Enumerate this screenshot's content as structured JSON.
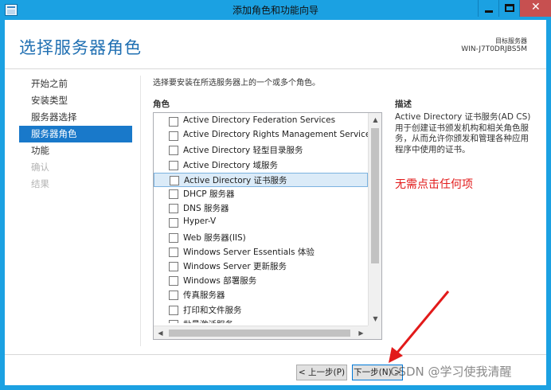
{
  "window": {
    "title": "添加角色和功能向导"
  },
  "header": {
    "page_title": "选择服务器角色",
    "target_label": "目标服务器",
    "target_name": "WIN-J7T0DRJBS5M"
  },
  "nav": {
    "items": [
      {
        "label": "开始之前",
        "state": "normal"
      },
      {
        "label": "安装类型",
        "state": "normal"
      },
      {
        "label": "服务器选择",
        "state": "normal"
      },
      {
        "label": "服务器角色",
        "state": "active"
      },
      {
        "label": "功能",
        "state": "normal"
      },
      {
        "label": "确认",
        "state": "disabled"
      },
      {
        "label": "结果",
        "state": "disabled"
      }
    ]
  },
  "main": {
    "instruction": "选择要安装在所选服务器上的一个或多个角色。",
    "roles_header": "角色",
    "description_header": "描述",
    "roles": [
      {
        "label": "Active Directory Federation Services",
        "checked": false,
        "selected": false
      },
      {
        "label": "Active Directory Rights Management Services",
        "checked": false,
        "selected": false
      },
      {
        "label": "Active Directory 轻型目录服务",
        "checked": false,
        "selected": false
      },
      {
        "label": "Active Directory 域服务",
        "checked": false,
        "selected": false
      },
      {
        "label": "Active Directory 证书服务",
        "checked": false,
        "selected": true
      },
      {
        "label": "DHCP 服务器",
        "checked": false,
        "selected": false
      },
      {
        "label": "DNS 服务器",
        "checked": false,
        "selected": false
      },
      {
        "label": "Hyper-V",
        "checked": false,
        "selected": false
      },
      {
        "label": "Web 服务器(IIS)",
        "checked": false,
        "selected": false
      },
      {
        "label": "Windows Server Essentials 体验",
        "checked": false,
        "selected": false
      },
      {
        "label": "Windows Server 更新服务",
        "checked": false,
        "selected": false
      },
      {
        "label": "Windows 部署服务",
        "checked": false,
        "selected": false
      },
      {
        "label": "传真服务器",
        "checked": false,
        "selected": false
      },
      {
        "label": "打印和文件服务",
        "checked": false,
        "selected": false
      },
      {
        "label": "批量激活服务",
        "checked": false,
        "selected": false
      }
    ],
    "description": "Active Directory 证书服务(AD CS) 用于创建证书颁发机构和相关角色服务，从而允许你颁发和管理各种应用程序中使用的证书。"
  },
  "annotation": {
    "text": "无需点击任何项",
    "color": "#e21a1a"
  },
  "footer": {
    "prev_label": "< 上一步(P)",
    "next_label": "下一步(N) >"
  },
  "watermark": "CSDN @学习使我清醒",
  "colors": {
    "titlebar": "#1ba1e2",
    "nav_active": "#1979ca",
    "page_title": "#1f6fb2",
    "selected_row": "#dbebf8"
  }
}
